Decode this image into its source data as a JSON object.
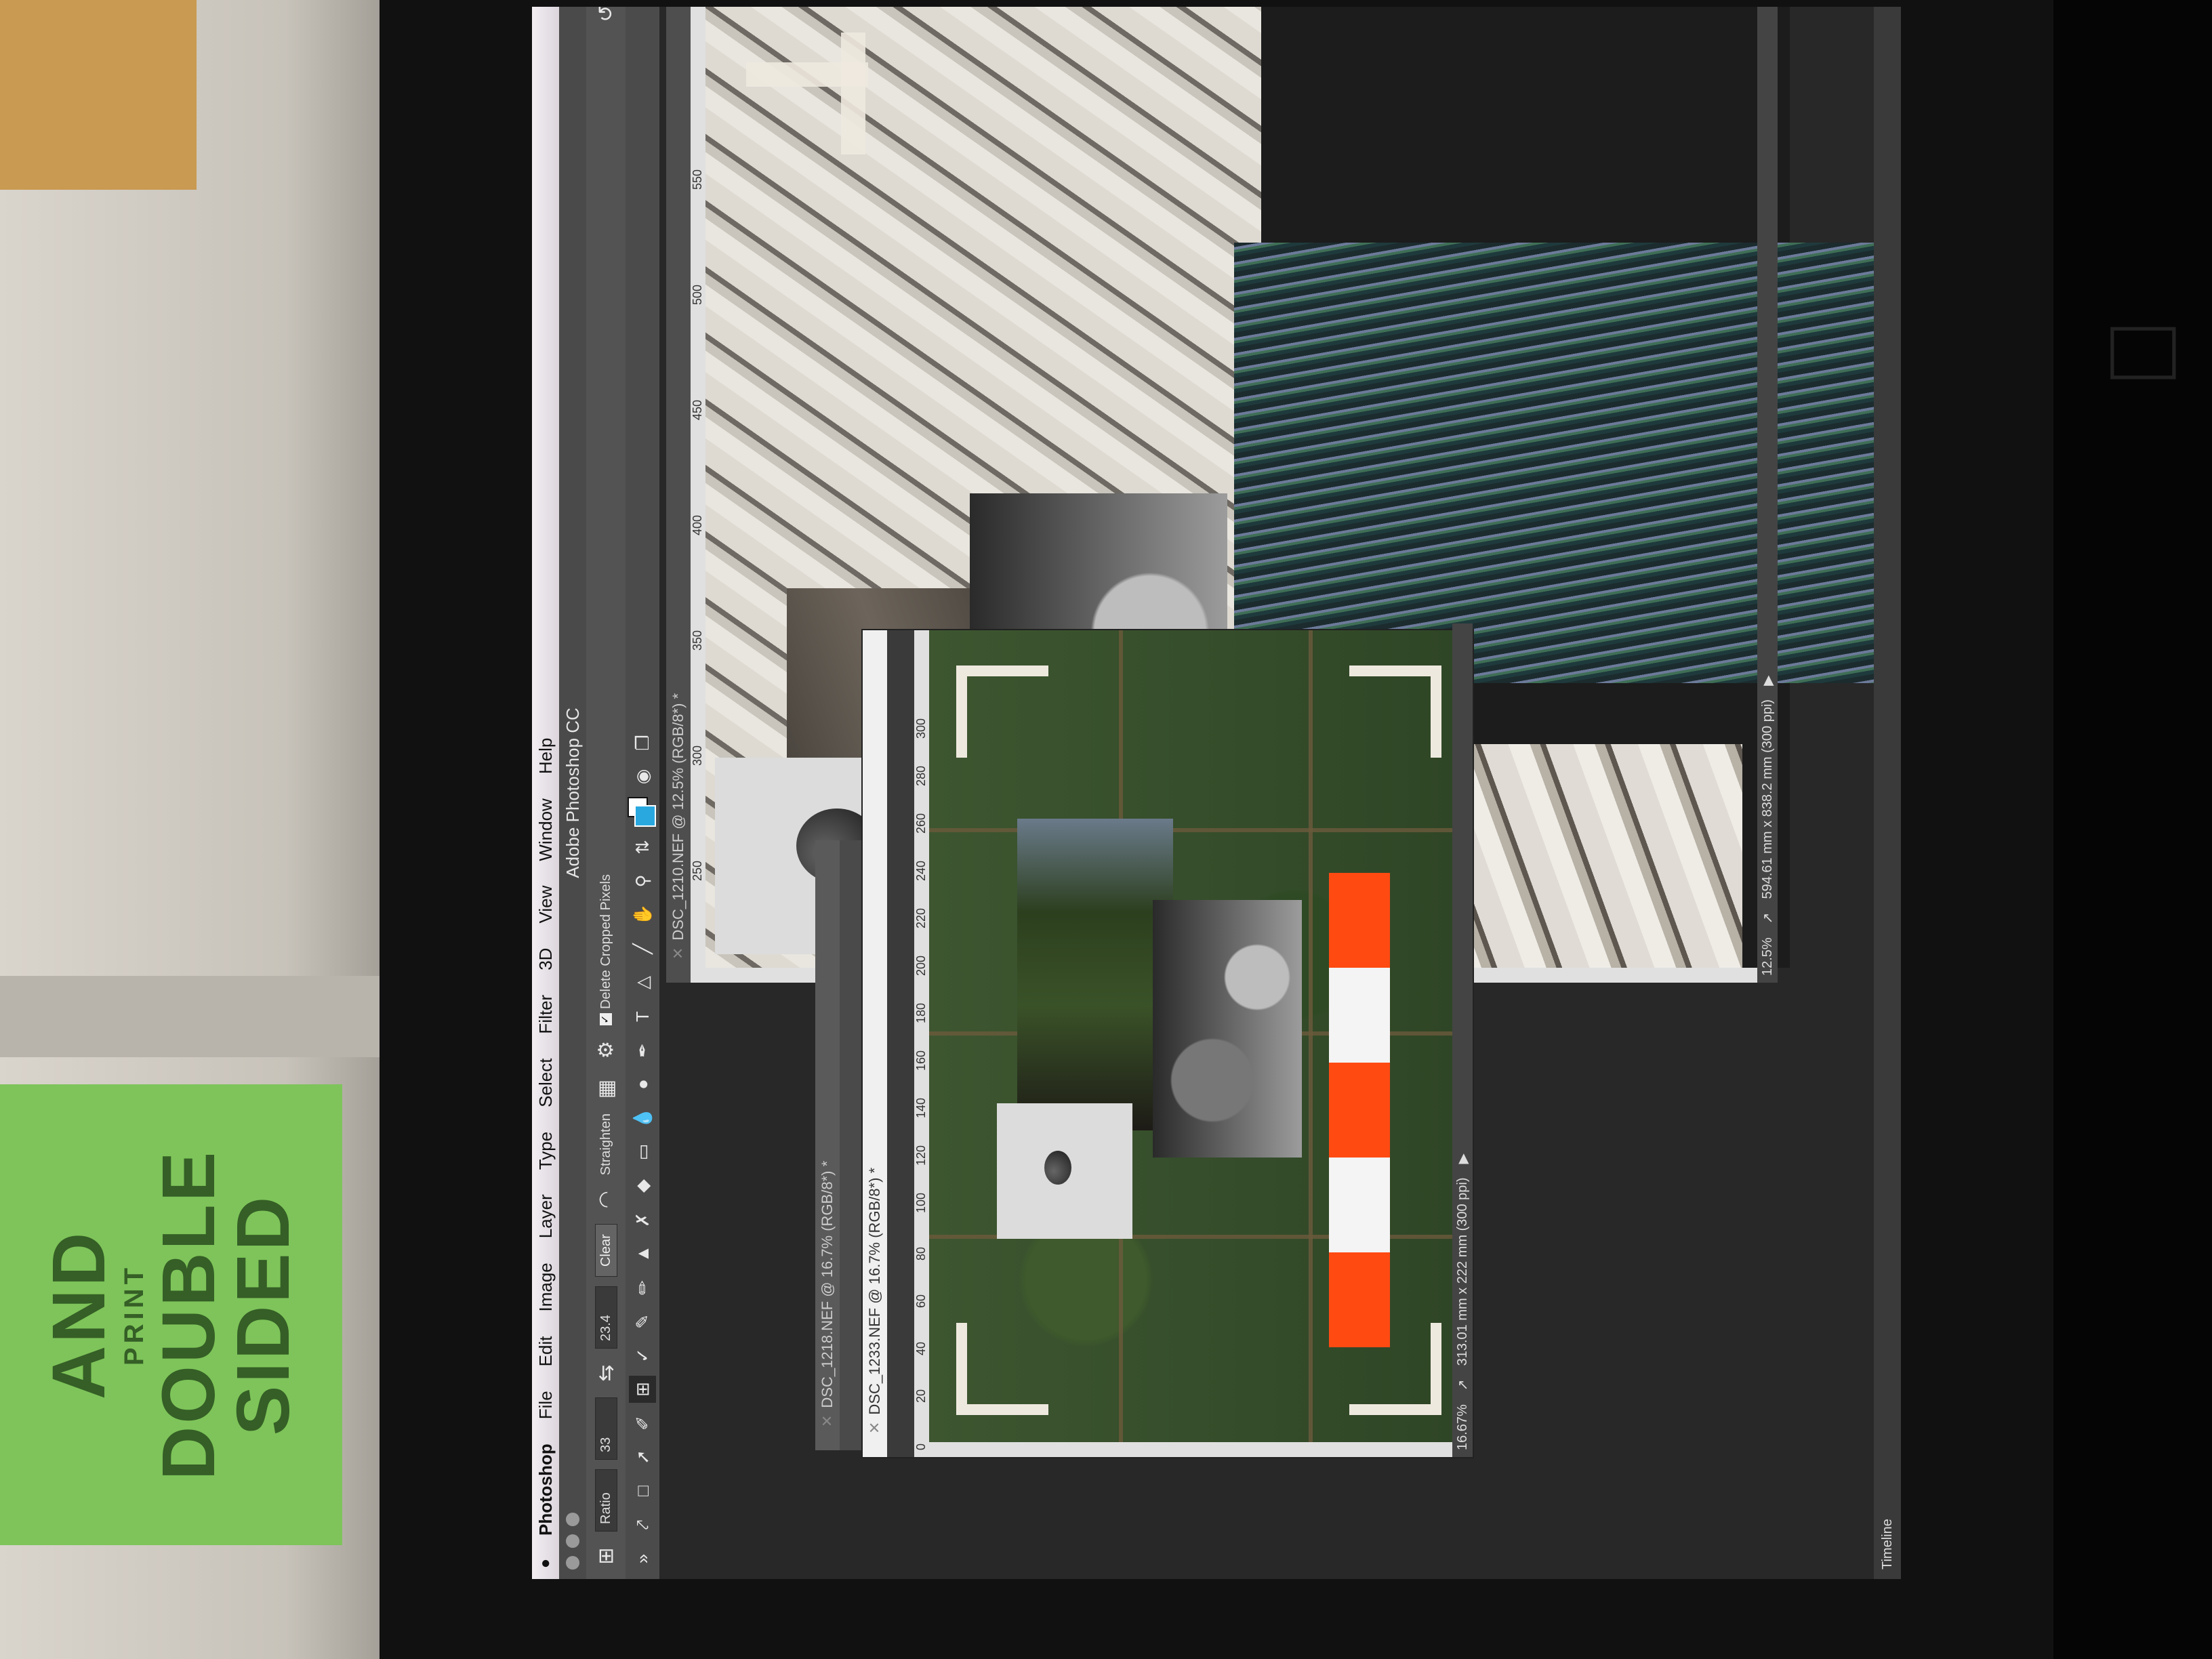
{
  "surroundings": {
    "sign_lines": [
      "AND",
      "PRINT",
      "DOUBLE",
      "SIDED"
    ]
  },
  "menubar": {
    "app": "Photoshop",
    "items": [
      "File",
      "Edit",
      "Image",
      "Layer",
      "Type",
      "Select",
      "Filter",
      "3D",
      "View",
      "Window",
      "Help"
    ]
  },
  "app_title": "Adobe Photoshop CC",
  "options": {
    "ratio": "Ratio",
    "width": "33",
    "height": "23.4",
    "clear": "Clear",
    "straighten": "Straighten",
    "delete_cropped": "Delete Cropped Pixels",
    "delete_cropped_checked": true
  },
  "tools": [
    "move",
    "marquee",
    "lasso",
    "quick-select",
    "crop",
    "eyedropper",
    "heal",
    "brush",
    "stamp",
    "history-brush",
    "eraser",
    "gradient",
    "blur",
    "dodge",
    "pen",
    "type",
    "path-select",
    "shape",
    "hand",
    "zoom"
  ],
  "colors": {
    "foreground": "#29a8e0",
    "background": "#ffffff",
    "accent_orange": "#ff4a12"
  },
  "doc1": {
    "tab": "DSC_1210.NEF @ 12.5% (RGB/8*) *",
    "ruler": [
      "250",
      "300",
      "350",
      "400",
      "450",
      "500",
      "550"
    ],
    "zoom": "12.5%",
    "size": "594.61 mm x 838.2 mm (300 ppi)"
  },
  "doc2": {
    "tab_back": "DSC_1218.NEF @ 16.7% (RGB/8*) *",
    "tab": "DSC_1233.NEF @ 16.7% (RGB/8*) *",
    "ruler": [
      "0",
      "20",
      "40",
      "60",
      "80",
      "100",
      "120",
      "140",
      "160",
      "180",
      "200",
      "220",
      "240",
      "260",
      "280",
      "300"
    ],
    "zoom": "16.67%",
    "size": "313.01 mm x 222 mm (300 ppi)"
  },
  "timeline": "Timeline"
}
